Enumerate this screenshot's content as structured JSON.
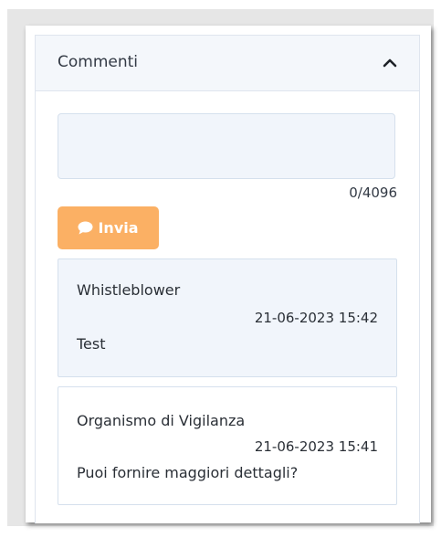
{
  "comments_panel": {
    "title": "Commenti",
    "toggle_icon": "chevron-up-icon",
    "input": {
      "value": "",
      "placeholder": ""
    },
    "char_counter": "0/4096",
    "send_button": {
      "label": "Invia",
      "icon": "comment-icon",
      "color": "#fbb064"
    },
    "comments": [
      {
        "author": "Whistleblower",
        "datetime": "21-06-2023 15:42",
        "text": "Test"
      },
      {
        "author": "Organismo di Vigilanza",
        "datetime": "21-06-2023 15:41",
        "text": "Puoi fornire maggiori dettagli?"
      }
    ]
  }
}
